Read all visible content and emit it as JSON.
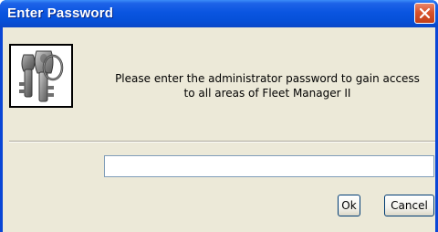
{
  "window": {
    "title": "Enter Password",
    "close_icon": "close-icon"
  },
  "dialog": {
    "icon": "keys-icon",
    "message_line1": "Please enter the administrator password to gain access",
    "message_line2": "to all areas of Fleet Manager II",
    "password_value": "",
    "ok_label": "Ok",
    "cancel_label": "Cancel"
  },
  "colors": {
    "titlebar": "#0a55e0",
    "close_button": "#d9532c",
    "client_background": "#ece9d8",
    "input_border": "#7f9db9",
    "button_border": "#003c74"
  }
}
